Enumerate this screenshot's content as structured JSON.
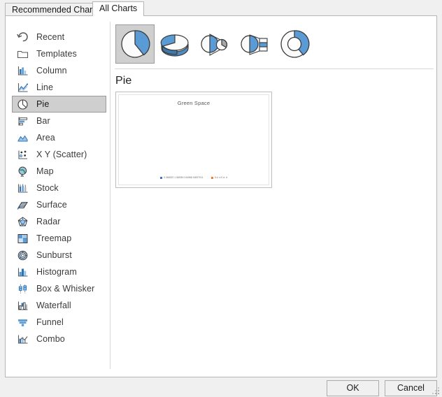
{
  "dialog": {
    "tabs": [
      {
        "label": "Recommended Charts",
        "active": false
      },
      {
        "label": "All Charts",
        "active": true
      }
    ],
    "buttons": {
      "ok": "OK",
      "cancel": "Cancel"
    }
  },
  "sidebar": {
    "items": [
      {
        "label": "Recent",
        "icon": "recent-icon",
        "selected": false
      },
      {
        "label": "Templates",
        "icon": "templates-icon",
        "selected": false
      },
      {
        "label": "Column",
        "icon": "column-icon",
        "selected": false
      },
      {
        "label": "Line",
        "icon": "line-icon",
        "selected": false
      },
      {
        "label": "Pie",
        "icon": "pie-icon",
        "selected": true
      },
      {
        "label": "Bar",
        "icon": "bar-icon",
        "selected": false
      },
      {
        "label": "Area",
        "icon": "area-icon",
        "selected": false
      },
      {
        "label": "X Y (Scatter)",
        "icon": "scatter-icon",
        "selected": false
      },
      {
        "label": "Map",
        "icon": "map-icon",
        "selected": false
      },
      {
        "label": "Stock",
        "icon": "stock-icon",
        "selected": false
      },
      {
        "label": "Surface",
        "icon": "surface-icon",
        "selected": false
      },
      {
        "label": "Radar",
        "icon": "radar-icon",
        "selected": false
      },
      {
        "label": "Treemap",
        "icon": "treemap-icon",
        "selected": false
      },
      {
        "label": "Sunburst",
        "icon": "sunburst-icon",
        "selected": false
      },
      {
        "label": "Histogram",
        "icon": "histogram-icon",
        "selected": false
      },
      {
        "label": "Box & Whisker",
        "icon": "box-whisker-icon",
        "selected": false
      },
      {
        "label": "Waterfall",
        "icon": "waterfall-icon",
        "selected": false
      },
      {
        "label": "Funnel",
        "icon": "funnel-icon",
        "selected": false
      },
      {
        "label": "Combo",
        "icon": "combo-icon",
        "selected": false
      }
    ]
  },
  "main": {
    "chart_type_heading": "Pie",
    "subtypes": [
      {
        "name": "pie-subtype-pie",
        "icon": "pie-2d-icon",
        "selected": true
      },
      {
        "name": "pie-subtype-3d-pie",
        "icon": "pie-3d-icon",
        "selected": false
      },
      {
        "name": "pie-subtype-pie-of-pie",
        "icon": "pie-of-pie-icon",
        "selected": false
      },
      {
        "name": "pie-subtype-bar-of-pie",
        "icon": "bar-of-pie-icon",
        "selected": false
      },
      {
        "name": "pie-subtype-doughnut",
        "icon": "doughnut-icon",
        "selected": false
      }
    ],
    "preview": {
      "title": "Green Space",
      "legend": [
        {
          "label": "0.368337.1 56935 0.54968 160079.8",
          "color": "#4472c4"
        },
        {
          "label": "0 d. d 0 d. d",
          "color": "#ed7d31"
        }
      ]
    }
  },
  "colors": {
    "accent_blue": "#5b9bd5",
    "series_blue": "#4472c4",
    "series_orange": "#ed7d31",
    "selection_gray": "#cfcfcf",
    "panel_bg": "#f0f0f0"
  }
}
